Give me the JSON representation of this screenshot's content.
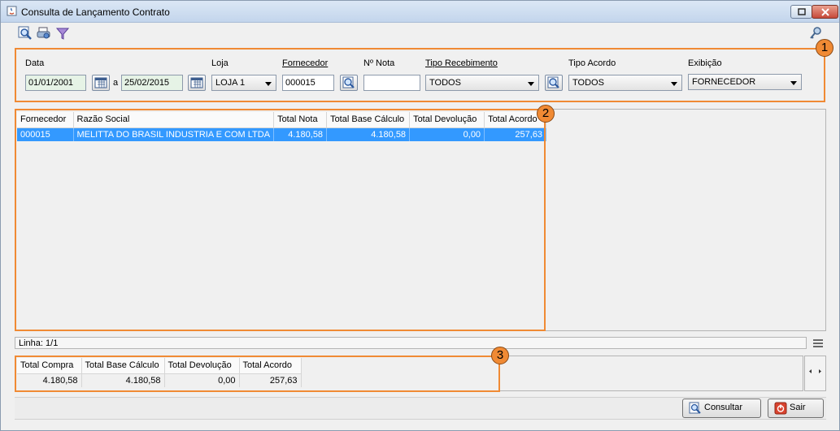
{
  "window": {
    "title": "Consulta de Lançamento Contrato"
  },
  "toolbar": {
    "icons": [
      "search-icon",
      "print-icon",
      "filter-icon",
      "key-icon"
    ]
  },
  "filters": {
    "data_label": "Data",
    "data_start": "01/01/2001",
    "data_sep": "a",
    "data_end": "25/02/2015",
    "loja_label": "Loja",
    "loja_value": "LOJA 1",
    "fornecedor_label": "Fornecedor",
    "fornecedor_value": "000015",
    "nota_label": "Nº Nota",
    "nota_value": "",
    "tipo_recebimento_label": "Tipo Recebimento",
    "tipo_recebimento_value": "TODOS",
    "tipo_acordo_label": "Tipo Acordo",
    "tipo_acordo_value": "TODOS",
    "exibicao_label": "Exibição",
    "exibicao_value": "FORNECEDOR"
  },
  "badges": [
    "1",
    "2",
    "3"
  ],
  "main_grid": {
    "columns": [
      "Fornecedor",
      "Razão Social",
      "Total Nota",
      "Total Base Cálculo",
      "Total Devolução",
      "Total Acordo"
    ],
    "rows": [
      [
        "000015",
        "MELITTA DO BRASIL INDUSTRIA E COM LTDA",
        "4.180,58",
        "4.180,58",
        "0,00",
        "257,63"
      ]
    ]
  },
  "status": {
    "linha": "Linha: 1/1"
  },
  "totals_grid": {
    "columns": [
      "Total Compra",
      "Total Base Cálculo",
      "Total Devolução",
      "Total Acordo"
    ],
    "rows": [
      [
        "4.180,58",
        "4.180,58",
        "0,00",
        "257,63"
      ]
    ]
  },
  "buttons": {
    "consultar": "Consultar",
    "sair": "Sair"
  },
  "colors": {
    "accent_orange": "#f08a34",
    "selection_blue": "#3399ff",
    "date_field_bg": "#e6f3e6"
  }
}
